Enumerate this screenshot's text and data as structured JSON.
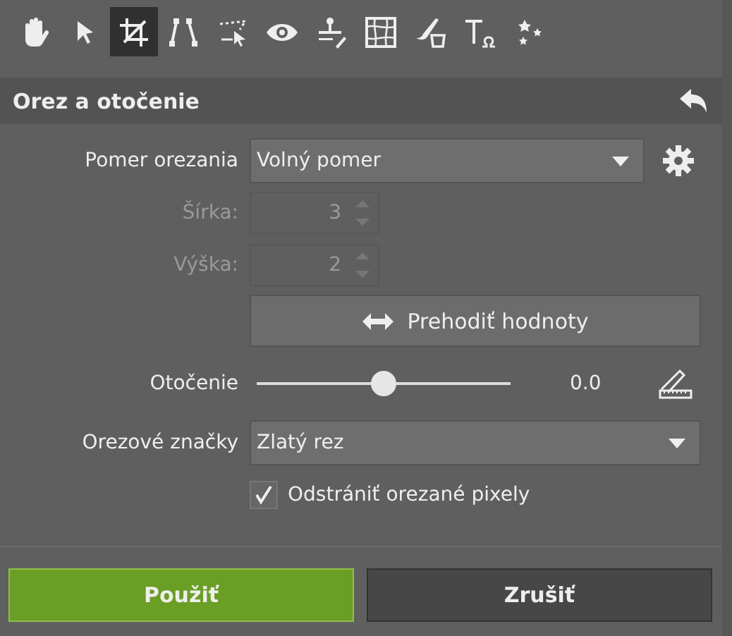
{
  "toolbar": {
    "tools": [
      {
        "kind": "hand",
        "selected": false
      },
      {
        "kind": "pointer",
        "selected": false
      },
      {
        "kind": "crop",
        "selected": true
      },
      {
        "kind": "lines",
        "selected": false
      },
      {
        "kind": "lasso",
        "selected": false
      },
      {
        "kind": "eye",
        "selected": false
      },
      {
        "kind": "stamp",
        "selected": false
      },
      {
        "kind": "warp",
        "selected": false
      },
      {
        "kind": "brush",
        "selected": false
      },
      {
        "kind": "text",
        "selected": false
      },
      {
        "kind": "stars",
        "selected": false
      }
    ]
  },
  "panel": {
    "title": "Orez a otočenie",
    "rows": [
      {
        "kind": "dropdown",
        "label": "Pomer orezania",
        "value": "Volný pomer",
        "gear": true
      },
      {
        "kind": "spinner",
        "label": "Šírka:",
        "value": "3",
        "disabled": true
      },
      {
        "kind": "spinner",
        "label": "Výška:",
        "value": "2",
        "disabled": true
      },
      {
        "kind": "button",
        "label": "Prehodiť hodnoty"
      },
      {
        "kind": "slider",
        "label": "Otočenie",
        "level": 0.5,
        "reading": "0.0"
      },
      {
        "kind": "dropdown",
        "label": "Orezové značky",
        "value": "Zlatý rez",
        "gear": false
      },
      {
        "kind": "checkbox",
        "label": "Odstrániť orezané pixely",
        "checked": true
      }
    ]
  },
  "actions": [
    {
      "label": "Použiť",
      "primary": true
    },
    {
      "label": "Zrušiť",
      "primary": false
    }
  ]
}
